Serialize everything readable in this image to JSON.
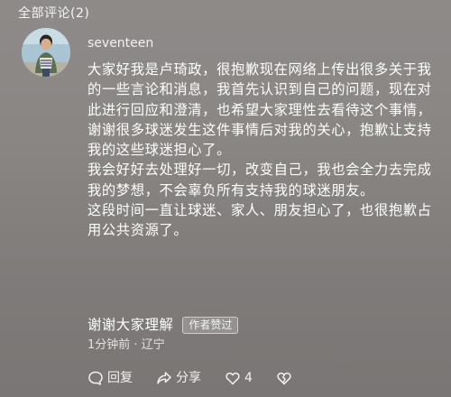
{
  "header": {
    "title": "全部评论(2)"
  },
  "comment": {
    "username": "seventeen",
    "paragraphs": [
      "大家好我是卢琦政，很抱歉现在网络上传出很多关于我的一些言论和消息，我首先认识到自己的问题，现在对此进行回应和澄清，也希望大家理性去看待这个事情，谢谢很多球迷发生这件事情后对我的关心，抱歉让支持我的这些球迷担心了。",
      "我会好好去处理好一切，改变自己，我也会全力去完成我的梦想，不会辜负所有支持我的球迷朋友。",
      "这段时间一直让球迷、家人、朋友担心了，也很抱歉占用公共资源了。"
    ],
    "last_line": "谢谢大家理解",
    "author_badge": "作者赞过",
    "time": "1分钟前",
    "separator": "·",
    "location": "辽宁"
  },
  "actions": {
    "reply_label": "回复",
    "share_label": "分享",
    "like_count": "4"
  },
  "colors": {
    "background": "#8a8684",
    "text": "#ffffff"
  },
  "icons": [
    "avatar",
    "reply-icon",
    "share-icon",
    "like-icon",
    "dislike-icon"
  ]
}
